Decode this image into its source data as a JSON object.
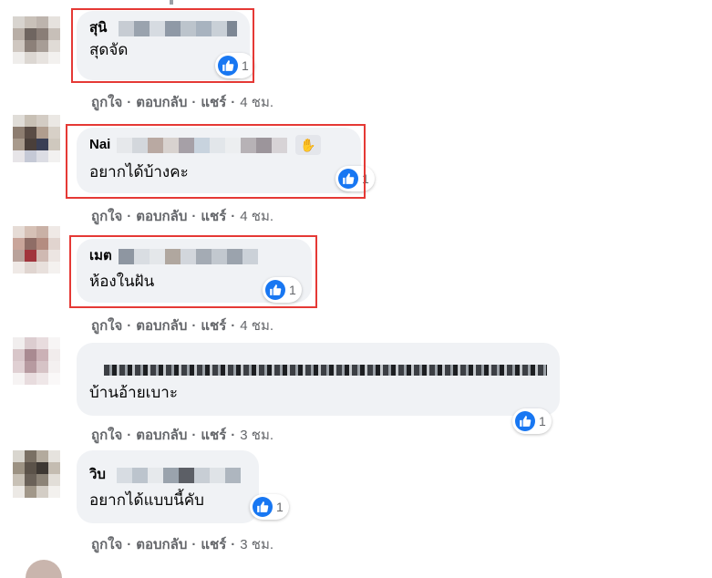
{
  "actions": {
    "like": "ถูกใจ",
    "reply": "ตอบกลับ",
    "share": "แชร์",
    "dot": "·"
  },
  "comments": [
    {
      "author": "สุนิ",
      "text": "สุดจัด",
      "reactions": "1",
      "time": "4 ชม."
    },
    {
      "author": "Nai",
      "text": "อยากได้บ้างคะ",
      "reactions": "1",
      "time": "4 ชม."
    },
    {
      "author": "เมต",
      "text": "ห้องในฝัน",
      "reactions": "1",
      "time": "4 ชม."
    },
    {
      "author": "",
      "text": "บ้านอ้ายเบาะ",
      "reactions": "1",
      "time": "3 ชม."
    },
    {
      "author": "วิบ",
      "text": "อยากได้แบบนี้คับ",
      "reactions": "1",
      "time": "3 ชม."
    }
  ],
  "colors": {
    "like_blue": "#1877f2",
    "highlight_red": "#e53935",
    "bubble_bg": "#f0f2f5",
    "meta_gray": "#65676b"
  },
  "icons": {
    "like": "thumbs-up-icon",
    "wave": "waving-hand-icon"
  }
}
